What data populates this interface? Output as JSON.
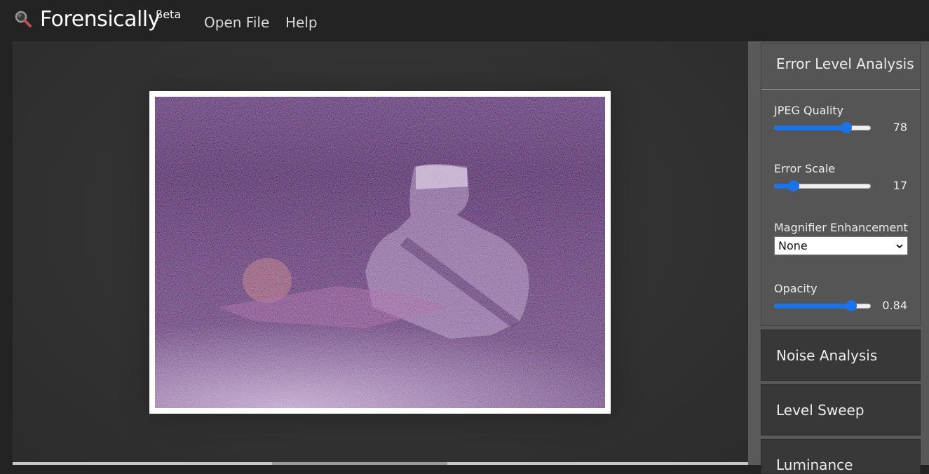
{
  "app": {
    "name": "Forensically",
    "superscript": "βeta"
  },
  "nav": {
    "open_file": "Open File",
    "help": "Help"
  },
  "icons": {
    "logo": "magnifier-icon",
    "select_arrow": "chevron-down-icon"
  },
  "colors": {
    "accent": "#1a73e8",
    "panel_bg": "#555555",
    "background": "#232323"
  },
  "tool_panel": {
    "title": "Error Level Analysis",
    "jpeg_quality": {
      "label": "JPEG Quality",
      "value": "78",
      "min": 0,
      "max": 100
    },
    "error_scale": {
      "label": "Error Scale",
      "value": "17",
      "min": 1,
      "max": 100
    },
    "magnifier": {
      "label": "Magnifier Enhancement",
      "selected": "None"
    },
    "opacity": {
      "label": "Opacity",
      "value": "0.84",
      "min": 0,
      "max": 1
    }
  },
  "other_tools": [
    {
      "label": "Noise Analysis"
    },
    {
      "label": "Level Sweep"
    },
    {
      "label": "Luminance"
    }
  ]
}
